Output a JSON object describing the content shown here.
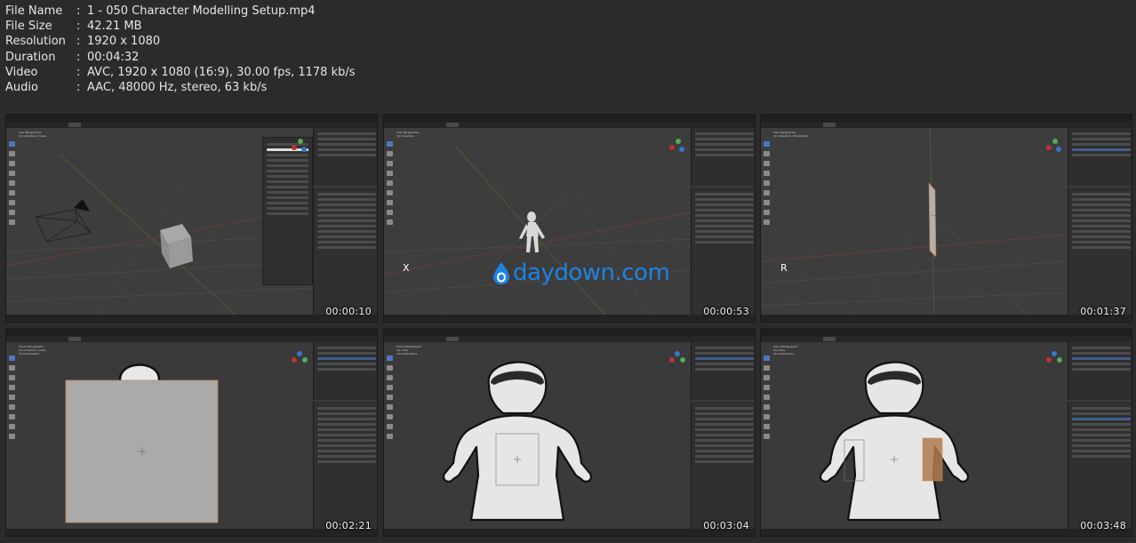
{
  "file_info": [
    {
      "key": "File Name",
      "value": "1 - 050 Character Modelling Setup.mp4"
    },
    {
      "key": "File Size",
      "value": "42.21 MB"
    },
    {
      "key": "Resolution",
      "value": "1920 x 1080"
    },
    {
      "key": "Duration",
      "value": "00:04:32"
    },
    {
      "key": "Video",
      "value": "AVC, 1920 x 1080 (16:9), 30.00 fps, 1178 kb/s"
    },
    {
      "key": "Audio",
      "value": "AAC, 48000 Hz, stereo, 63 kb/s"
    }
  ],
  "separator": ":",
  "thumbnails": [
    {
      "timestamp": "00:00:10",
      "key_overlay": ""
    },
    {
      "timestamp": "00:00:53",
      "key_overlay": "X",
      "watermark": "daydown.com"
    },
    {
      "timestamp": "00:01:37",
      "key_overlay": "R"
    },
    {
      "timestamp": "00:02:21",
      "key_overlay": ""
    },
    {
      "timestamp": "00:03:04",
      "key_overlay": ""
    },
    {
      "timestamp": "00:03:48",
      "key_overlay": ""
    }
  ],
  "colors": {
    "background": "#2b2b2b",
    "blender_ui": "#3d3d3d",
    "watermark": "#1d83e0",
    "selection": "#4a78c2"
  }
}
